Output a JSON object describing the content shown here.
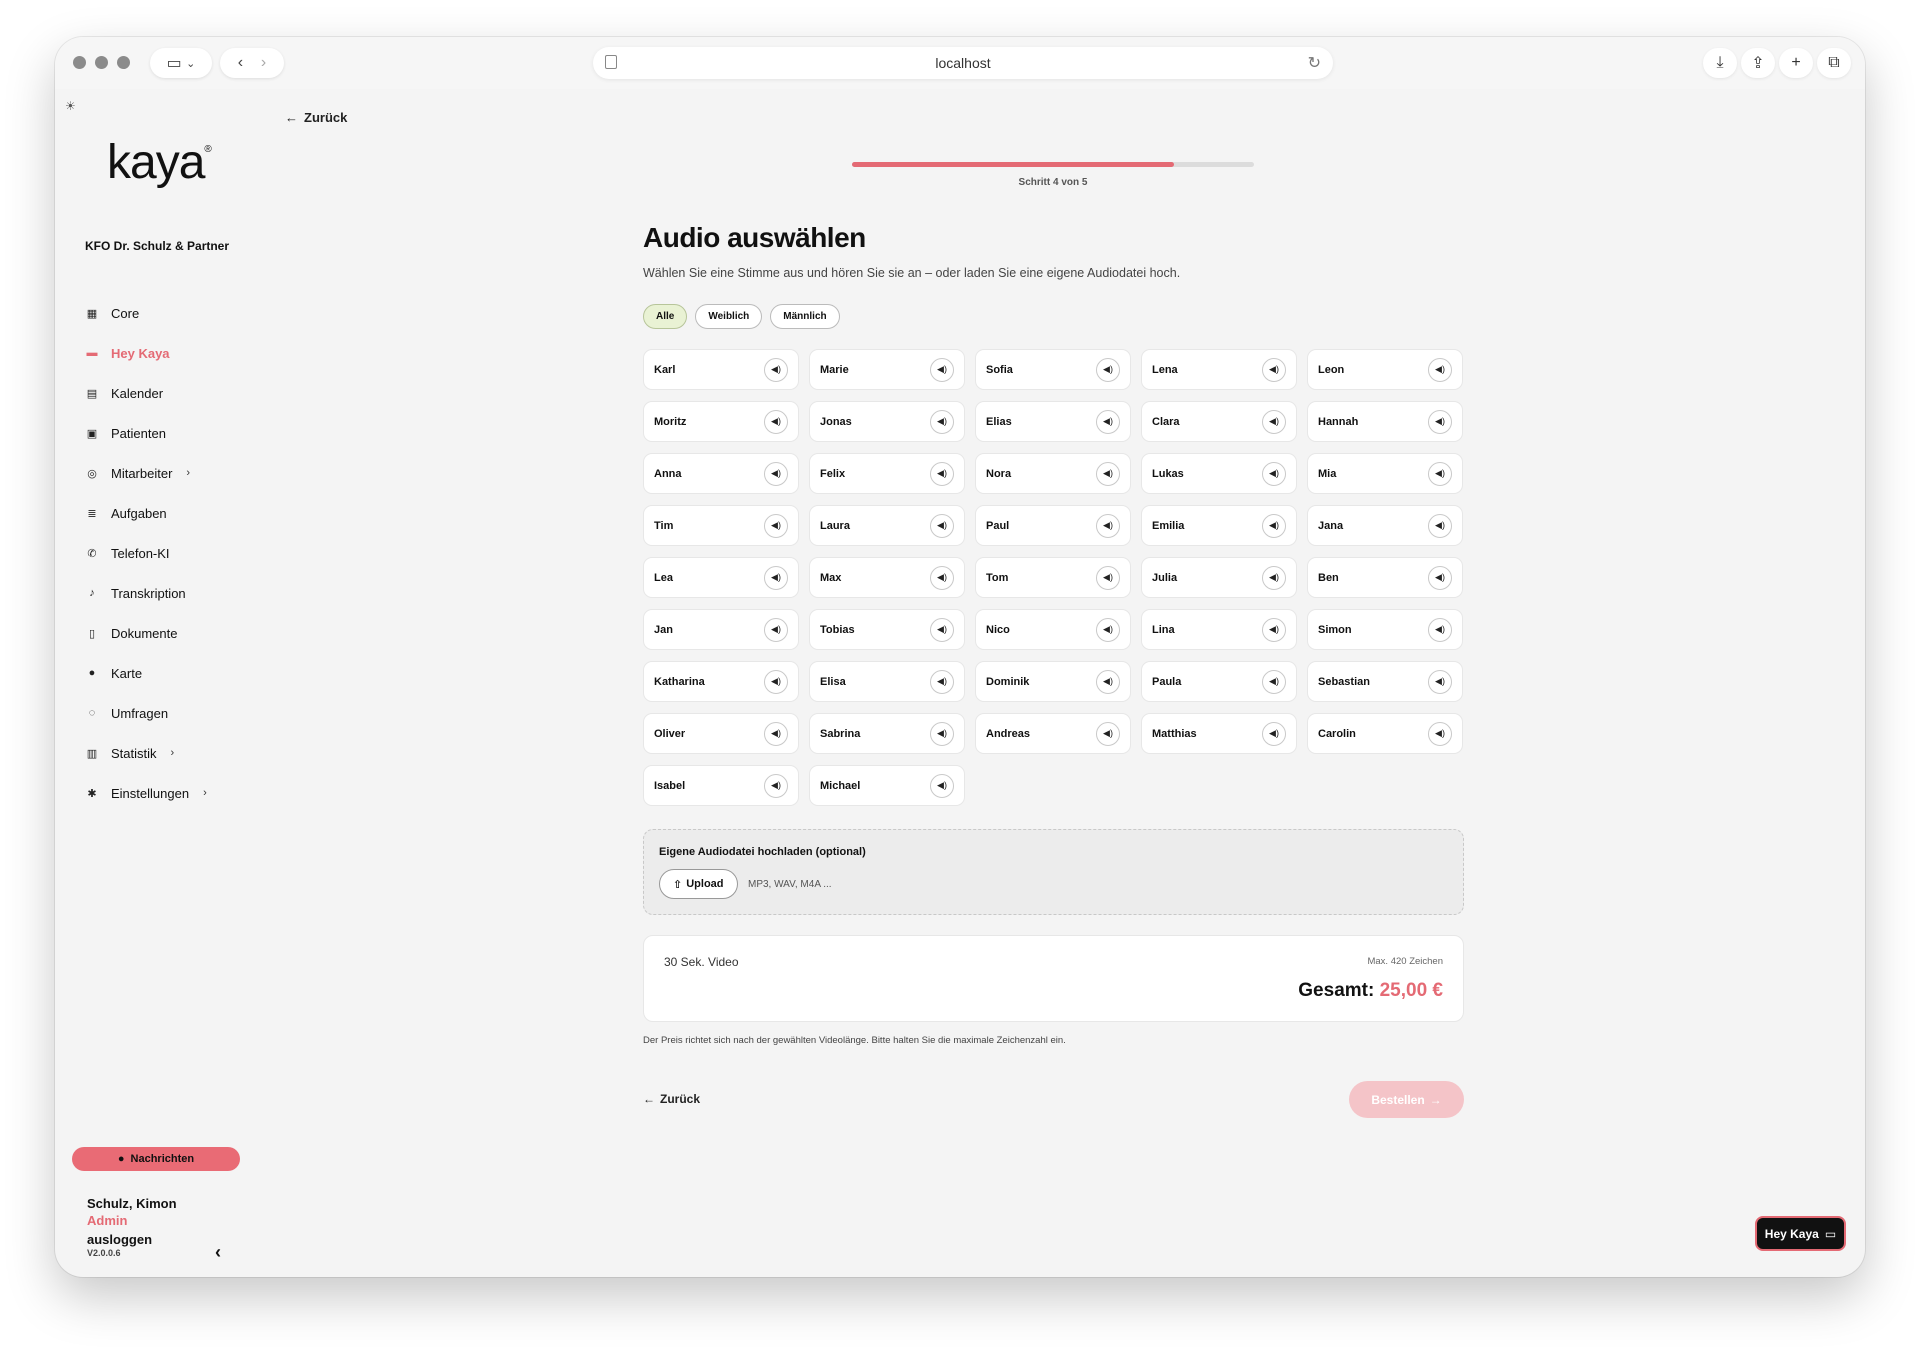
{
  "browser": {
    "url": "localhost",
    "icons": [
      "sidebar-toggle-icon",
      "chevron-down-icon",
      "back-icon",
      "forward-icon",
      "reload-icon",
      "download-icon",
      "share-icon",
      "plus-icon",
      "tabs-icon"
    ]
  },
  "header": {
    "back_label": "Zurück"
  },
  "sidebar": {
    "logo": "kaya",
    "practice": "KFO Dr. Schulz & Partner",
    "items": [
      {
        "label": "Core",
        "icon": "grid-icon",
        "active": false,
        "chevron": false
      },
      {
        "label": "Hey Kaya",
        "icon": "chat-icon",
        "active": true,
        "chevron": false
      },
      {
        "label": "Kalender",
        "icon": "calendar-icon",
        "active": false,
        "chevron": false
      },
      {
        "label": "Patienten",
        "icon": "id-card-icon",
        "active": false,
        "chevron": false
      },
      {
        "label": "Mitarbeiter",
        "icon": "user-circle-icon",
        "active": false,
        "chevron": true
      },
      {
        "label": "Aufgaben",
        "icon": "tasks-icon",
        "active": false,
        "chevron": false
      },
      {
        "label": "Telefon-KI",
        "icon": "phone-icon",
        "active": false,
        "chevron": false
      },
      {
        "label": "Transkription",
        "icon": "microphone-icon",
        "active": false,
        "chevron": false
      },
      {
        "label": "Dokumente",
        "icon": "document-icon",
        "active": false,
        "chevron": false
      },
      {
        "label": "Karte",
        "icon": "map-pin-icon",
        "active": false,
        "chevron": false
      },
      {
        "label": "Umfragen",
        "icon": "survey-icon",
        "active": false,
        "chevron": false
      },
      {
        "label": "Statistik",
        "icon": "bar-chart-icon",
        "active": false,
        "chevron": true
      },
      {
        "label": "Einstellungen",
        "icon": "gears-icon",
        "active": false,
        "chevron": true
      }
    ],
    "messages_label": "Nachrichten",
    "user": {
      "name": "Schulz, Kimon",
      "role": "Admin",
      "logout": "ausloggen",
      "version": "V2.0.0.6"
    }
  },
  "wizard": {
    "step_label": "Schritt 4 von 5",
    "progress": 0.8,
    "title": "Audio auswählen",
    "subtitle": "Wählen Sie eine Stimme aus und hören Sie sie an – oder laden Sie eine eigene Audiodatei hoch.",
    "filters": [
      {
        "label": "Alle",
        "active": true
      },
      {
        "label": "Weiblich",
        "active": false
      },
      {
        "label": "Männlich",
        "active": false
      }
    ],
    "voices": [
      "Karl",
      "Marie",
      "Sofia",
      "Lena",
      "Leon",
      "Moritz",
      "Jonas",
      "Elias",
      "Clara",
      "Hannah",
      "Anna",
      "Felix",
      "Nora",
      "Lukas",
      "Mia",
      "Tim",
      "Laura",
      "Paul",
      "Emilia",
      "Jana",
      "Lea",
      "Max",
      "Tom",
      "Julia",
      "Ben",
      "Jan",
      "Tobias",
      "Nico",
      "Lina",
      "Simon",
      "Katharina",
      "Elisa",
      "Dominik",
      "Paula",
      "Sebastian",
      "Oliver",
      "Sabrina",
      "Andreas",
      "Matthias",
      "Carolin",
      "Isabel",
      "Michael"
    ],
    "upload": {
      "title": "Eigene Audiodatei hochladen (optional)",
      "button": "Upload",
      "hint": "MP3, WAV, M4A ..."
    },
    "pricing": {
      "video": "30 Sek. Video",
      "max_chars": "Max. 420 Zeichen",
      "total_label": "Gesamt:",
      "total_amount": "25,00 €"
    },
    "note": "Der Preis richtet sich nach der gewählten Videolänge. Bitte halten Sie die maximale Zeichenzahl ein.",
    "back_label": "Zurück",
    "order_label": "Bestellen"
  },
  "assistant_button": "Hey Kaya",
  "colors": {
    "accent": "#e46a74",
    "accent_light": "#f4c4c8",
    "chip_active": "#e9f2d4",
    "background": "#f4f4f4"
  }
}
